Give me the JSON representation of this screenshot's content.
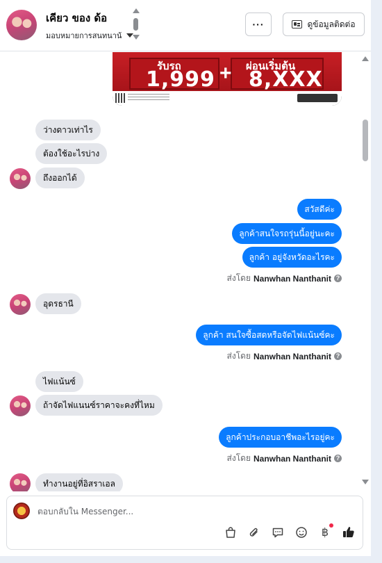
{
  "header": {
    "name": "เคียว ของ ด้อ",
    "assign_label": "มอบหมายการสนทนาน้",
    "more_label": "···",
    "contact_button_label": "ดูข้อมูลติดต่อ"
  },
  "banner": {
    "label_left": "รับรถ",
    "value_left": "1,999",
    "plus": "+",
    "label_right": "ผ่อนเริ่มต้น",
    "value_right": "8,XXX"
  },
  "messages": {
    "in_1": "ว่างดาวเท่าไร",
    "in_2": "ต้องใช้อะไรบ่าง",
    "in_3": "ถึงออกได้",
    "out_1": "สวัสดีค่ะ",
    "out_2": "ลูกค้าสนใจรถรุ่นนี้อยู่นะคะ",
    "out_3": "ลูกค้า อยู่จังหวัดอะไรคะ",
    "in_4": "อุดรธานี",
    "out_4": "ลูกค้า สนใจซื้อสดหรือจัดไฟแน้นซ์คะ",
    "in_5": "ไฟแน้นซ์",
    "in_6": "ถ้าจัดไฟแนนซ์ราคาจะคงที่ไหม",
    "out_5": "ลูกค้าประกอบอาชีพอะไรอยู่คะ",
    "in_7": "ทำงานอยู่ที่อิสราเอล"
  },
  "sent_by": {
    "prefix": "ส่งโดย",
    "name": "Nanwhan Nanthanit",
    "info_glyph": "?"
  },
  "composer": {
    "placeholder": "ตอบกลับใน Messenger...",
    "baht_glyph": "฿"
  },
  "icons": [
    "shopping-bag-icon",
    "paperclip-icon",
    "saved-reply-icon",
    "emoji-icon",
    "baht-icon",
    "thumbs-up-icon"
  ],
  "colors": {
    "outgoing_bubble": "#0a7cff",
    "incoming_bubble": "#e4e6eb",
    "banner_red": "#c71f25"
  }
}
